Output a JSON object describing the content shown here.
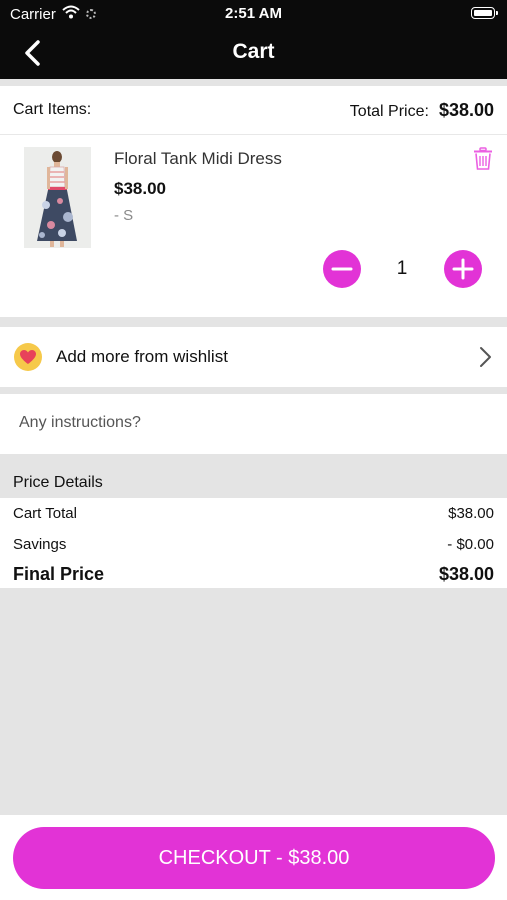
{
  "status_bar": {
    "carrier": "Carrier",
    "time": "2:51 AM"
  },
  "nav": {
    "title": "Cart"
  },
  "summary": {
    "cart_items_label": "Cart Items:",
    "total_label": "Total Price:",
    "total_value": "$38.00"
  },
  "item": {
    "name": "Floral Tank Midi Dress",
    "price": "$38.00",
    "variant": "- S",
    "quantity": "1",
    "image_icon": "dress-photo"
  },
  "wishlist": {
    "label": "Add more from wishlist",
    "icon": "heart-icon"
  },
  "instructions": {
    "placeholder": "Any instructions?"
  },
  "price_details": {
    "header": "Price Details",
    "rows": [
      {
        "label": "Cart Total",
        "value": "$38.00"
      },
      {
        "label": "Savings",
        "value": "- $0.00"
      },
      {
        "label": "Final Price",
        "value": "$38.00"
      }
    ]
  },
  "checkout": {
    "label": "CHECKOUT - $38.00"
  },
  "colors": {
    "accent": "#e233d6",
    "nav_bg": "#0b0b0b",
    "wishlist_badge": "#f6c94a"
  }
}
